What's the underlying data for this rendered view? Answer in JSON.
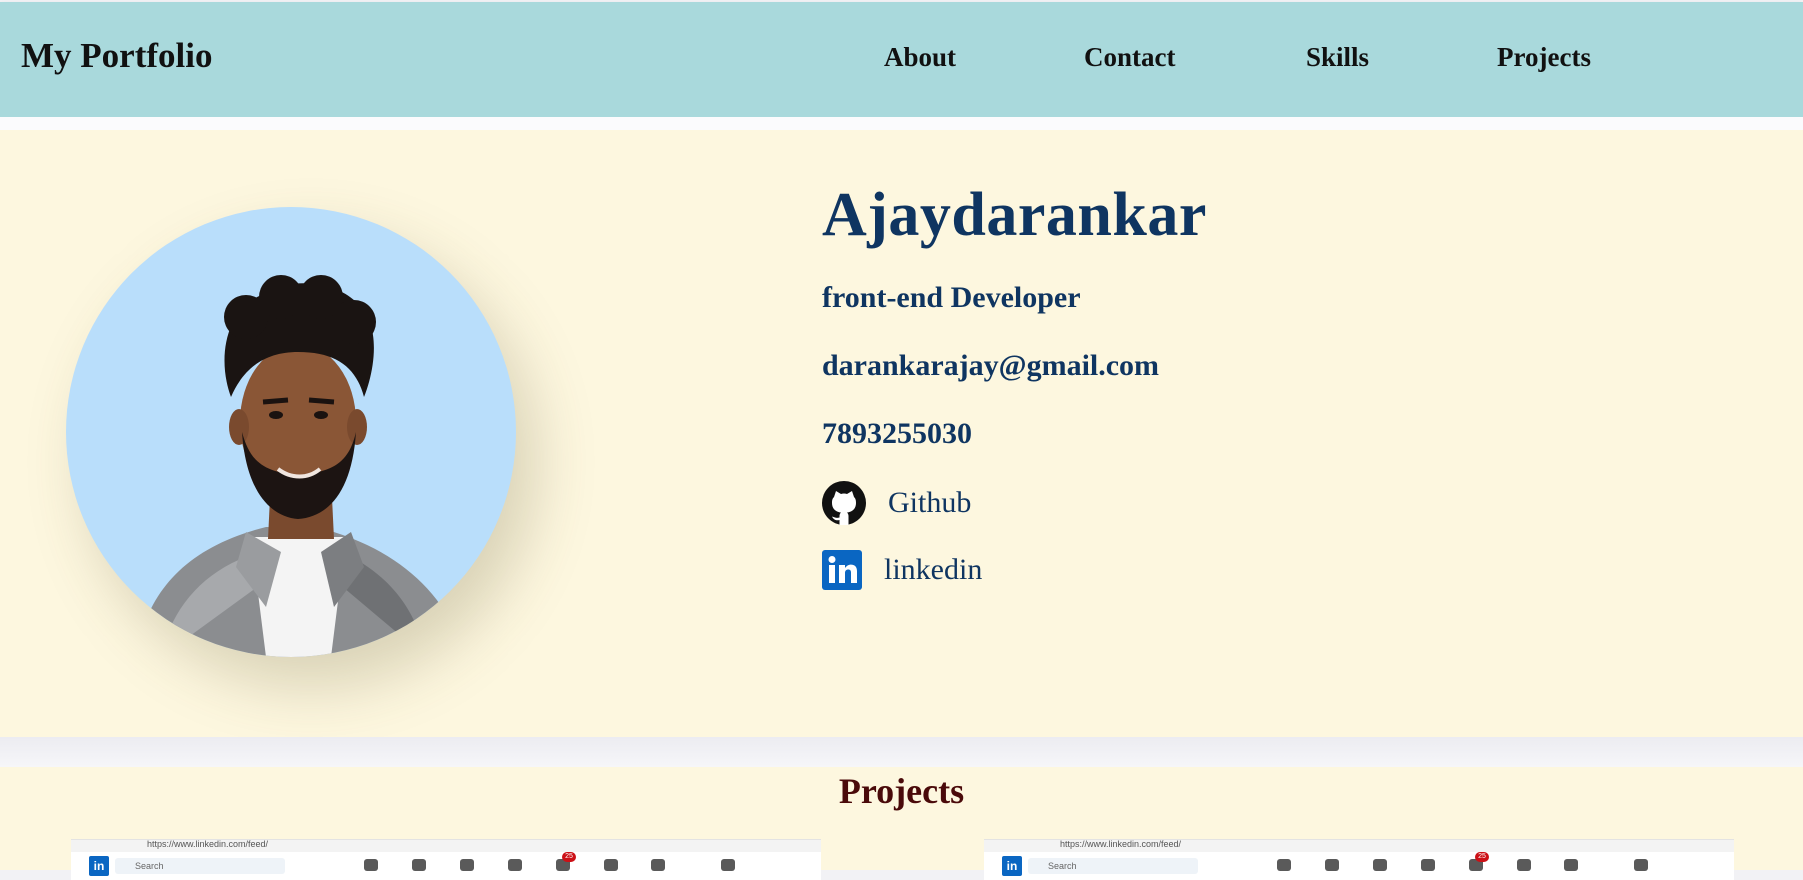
{
  "navbar": {
    "brand": "My Portfolio",
    "links": [
      "About",
      "Contact",
      "Skills",
      "Projects"
    ]
  },
  "hero": {
    "name": "Ajaydarankar",
    "role": "front-end Developer",
    "email": "darankarajay@gmail.com",
    "phone": "7893255030",
    "social": [
      {
        "label": "Github",
        "icon": "github-icon"
      },
      {
        "label": "linkedin",
        "icon": "linkedin-icon"
      }
    ]
  },
  "projects": {
    "title": "Projects",
    "thumbnails": [
      {
        "url": "https://www.linkedin.com/feed/",
        "search": "Search",
        "badge": "25"
      },
      {
        "url": "https://www.linkedin.com/feed/",
        "search": "Search",
        "badge": "25"
      }
    ]
  },
  "colors": {
    "navbar_bg": "#a9d9dc",
    "hero_bg": "#fdf7df",
    "heading_text": "#0f3561",
    "projects_title": "#4a0a0a",
    "avatar_bg": "#b9defb"
  }
}
